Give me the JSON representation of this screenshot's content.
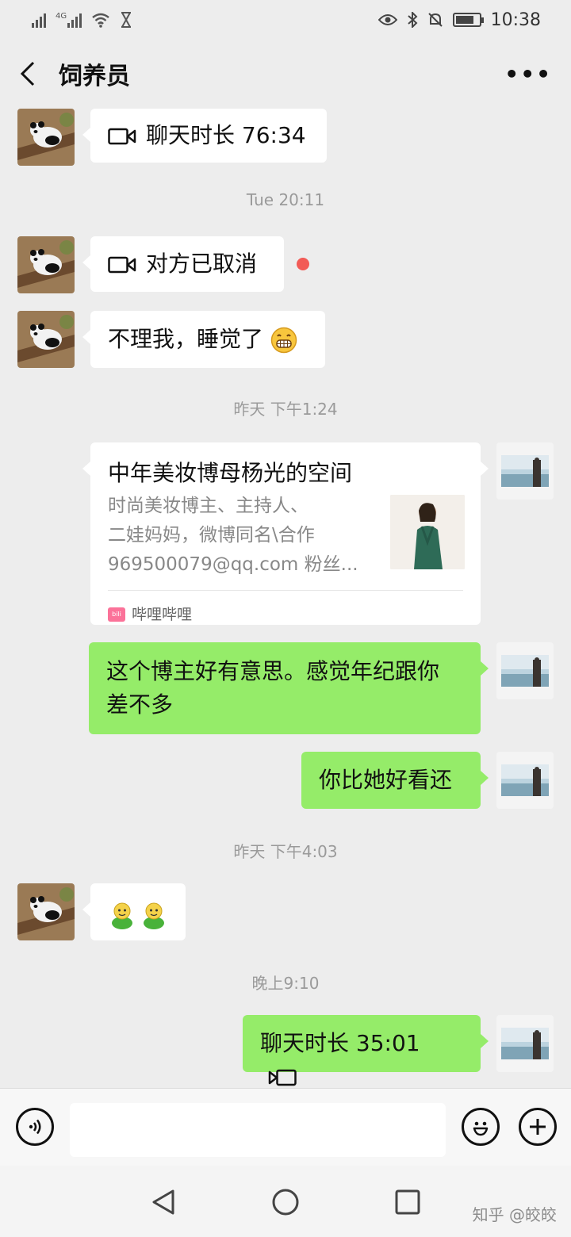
{
  "status_bar": {
    "net_label": "4G",
    "time": "10:38",
    "battery_level": 0.8
  },
  "header": {
    "title": "饲养员",
    "more": "•••"
  },
  "messages": {
    "m1": "聊天时长 76:34",
    "t1": "Tue 20:11",
    "m2": "对方已取消",
    "m3": "不理我，睡觉了",
    "t2": "昨天 下午1:24",
    "card": {
      "title": "中年美妆博母杨光的空间",
      "desc_lines": [
        "时尚美妆博主、主持人、",
        "二娃妈妈，微博同名\\合作",
        "969500079@qq.com 粉丝..."
      ],
      "source": "哔哩哔哩",
      "logo_text": "bili"
    },
    "m4_line1": "这个博主好有意思。感觉年纪跟你",
    "m4_line2": "差不多",
    "m5": "你比她好看还",
    "t3": "昨天 下午4:03",
    "t4": "晚上9:10",
    "m7": "聊天时长 35:01"
  },
  "watermark": "知乎 @皎皎",
  "colors": {
    "background": "#ededed",
    "my_bubble": "#95ec69",
    "other_bubble": "#ffffff",
    "unread": "#f25b56"
  },
  "icons": [
    "back-arrow-icon",
    "more-icon",
    "video-call-icon",
    "grin-emoji-icon",
    "green-sprite-emoji-icon",
    "voice-icon",
    "emoji-icon",
    "plus-icon",
    "nav-back-icon",
    "nav-home-icon",
    "nav-recent-icon"
  ]
}
